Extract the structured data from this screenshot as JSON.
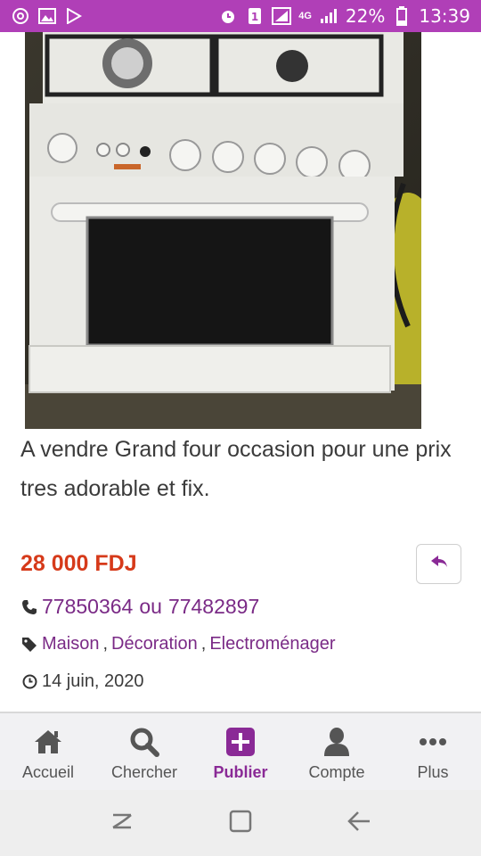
{
  "status_bar": {
    "battery": "22%",
    "time": "13:39",
    "network": "4G",
    "sim": "1",
    "bg_color": "#b03fb7"
  },
  "listing": {
    "image_alt": "Grand four gazinière blanche",
    "description": "A vendre Grand four occasion pour une prix tres adorable et fix.",
    "price": "28 000 FDJ",
    "phone_1": "77850364",
    "phone_or": "ou",
    "phone_2": "77482897",
    "categories": [
      "Maison",
      "Décoration",
      "Electroménager"
    ],
    "date": "14 juin, 2020",
    "price_color": "#d63a1a",
    "link_color": "#7a2a86"
  },
  "bottom_nav": {
    "items": [
      {
        "label": "Accueil",
        "icon": "home-icon"
      },
      {
        "label": "Chercher",
        "icon": "search-icon"
      },
      {
        "label": "Publier",
        "icon": "plus-square-icon",
        "active": true
      },
      {
        "label": "Compte",
        "icon": "user-icon"
      },
      {
        "label": "Plus",
        "icon": "more-icon"
      }
    ],
    "active_color": "#8a2a96"
  },
  "system_nav": {
    "buttons": [
      "recents-icon",
      "home-button-icon",
      "back-icon"
    ]
  }
}
